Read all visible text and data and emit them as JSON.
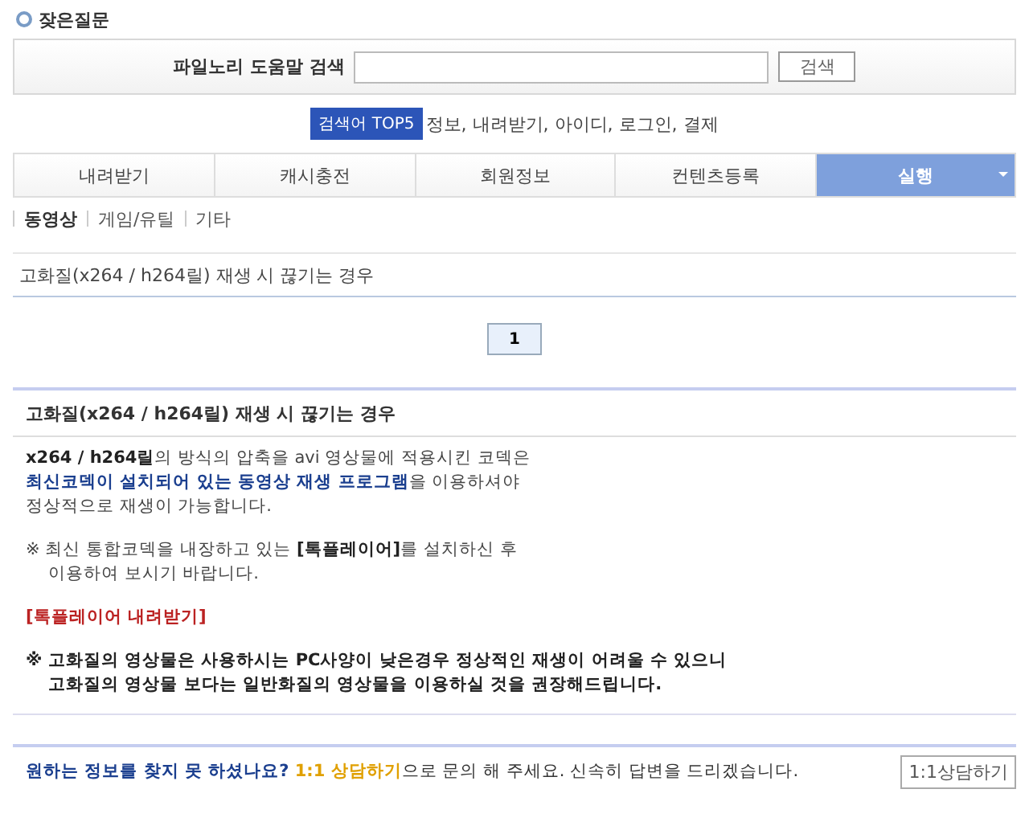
{
  "page_title": "잦은질문",
  "search": {
    "label": "파일노리 도움말 검색",
    "button": "검색"
  },
  "top5": {
    "badge": "검색어 TOP5",
    "terms": "정보, 내려받기, 아이디, 로그인, 결제"
  },
  "tabs": [
    {
      "label": "내려받기",
      "selected": false
    },
    {
      "label": "캐시충전",
      "selected": false
    },
    {
      "label": "회원정보",
      "selected": false
    },
    {
      "label": "컨텐츠등록",
      "selected": false
    },
    {
      "label": "실행",
      "selected": true
    }
  ],
  "subtabs": [
    {
      "label": "동영상",
      "selected": true
    },
    {
      "label": "게임/유틸",
      "selected": false
    },
    {
      "label": "기타",
      "selected": false
    }
  ],
  "questions": [
    "고화질(x264 / h264릴) 재생 시 끊기는 경우"
  ],
  "pages": [
    {
      "label": "1",
      "selected": true
    }
  ],
  "answer": {
    "title": "고화질(x264 / h264릴) 재생 시 끊기는 경우",
    "paragraphs": [
      {
        "kind": "text",
        "lines": [
          "**x264 / h264릴**의 방식의 압축을 avi 영상물에 적용시킨 코덱은",
          "**최신코덱이 설치되어 있는 동영상 재생 프로그램**을 이용하셔야",
          "정상적으로 재생이 가능합니다."
        ]
      },
      {
        "kind": "note",
        "lines": [
          "※ 최신 통합코덱을 내장하고 있는 **[톡플레이어]**를 설치하신 후",
          "이용하여 보시기 바랍니다."
        ]
      },
      {
        "kind": "link",
        "lines": [
          "[톡플레이어 내려받기]"
        ]
      },
      {
        "kind": "warning",
        "lines": [
          "※ 고화질의 영상물은 사용하시는 PC사양이 낮은경우 정상적인 재생이 어려울 수 있으니",
          "고화질의 영상물 보다는 일반화질의 영상물을 이용하실 것을 권장해드립니다."
        ]
      }
    ]
  },
  "footer": {
    "question": "원하는 정보를 찾지 못 하셨나요?",
    "link": "1:1 상담하기",
    "rest": "으로 문의 해 주세요. 신속히 답변을 드리겠습니다.",
    "button": "1:1상담하기"
  }
}
